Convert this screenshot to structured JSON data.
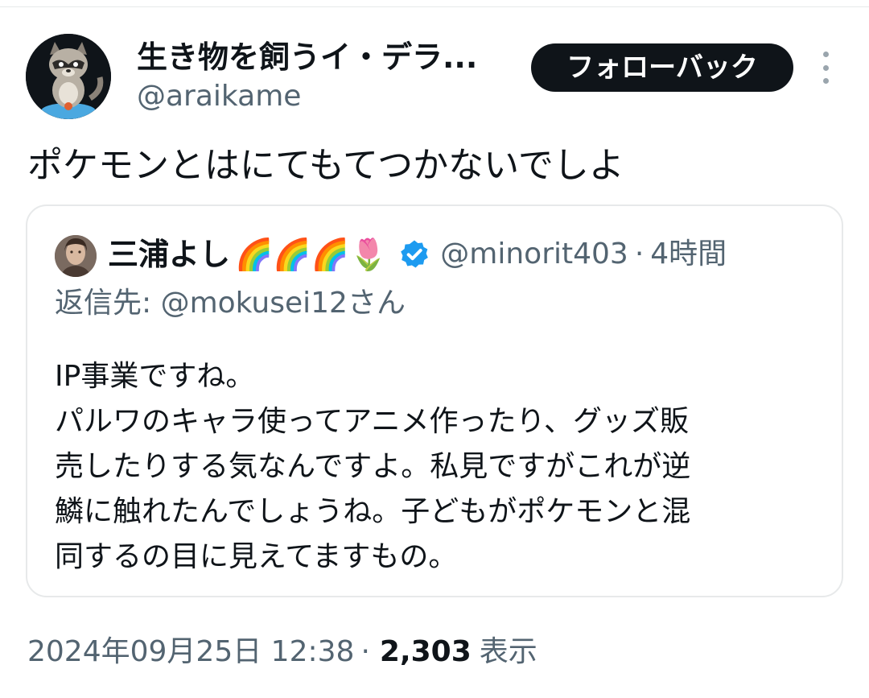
{
  "author": {
    "display_name": "生き物を飼うイ・デラ...",
    "handle": "@araikame",
    "follow_button_label": "フォローバック"
  },
  "tweet": {
    "text": "ポケモンとはにてもてつかないでしよ",
    "date": "2024年09月25日 12:38",
    "separator": "·",
    "views_count": "2,303",
    "views_label": "表示"
  },
  "quoted": {
    "name": "三浦よし",
    "emoji": "🌈🌈🌈🌷",
    "handle": "@minorit403",
    "separator": "·",
    "time": "4時間",
    "reply_to": "返信先: @mokusei12さん",
    "lines": [
      "IP事業ですね。",
      "パルワのキャラ使ってアニメ作ったり、グッズ販",
      "売したりする気なんですよ。私見ですがこれが逆",
      "鱗に触れたんでしょうね。子どもがポケモンと混",
      "同するの目に見えてますもの。"
    ]
  },
  "colors": {
    "text_primary": "#0f1419",
    "text_secondary": "#536471",
    "border": "#e7e9ea",
    "verified": "#1d9bf0"
  },
  "icons": {
    "more": "more-vertical-icon",
    "verified": "verified-badge-icon"
  }
}
